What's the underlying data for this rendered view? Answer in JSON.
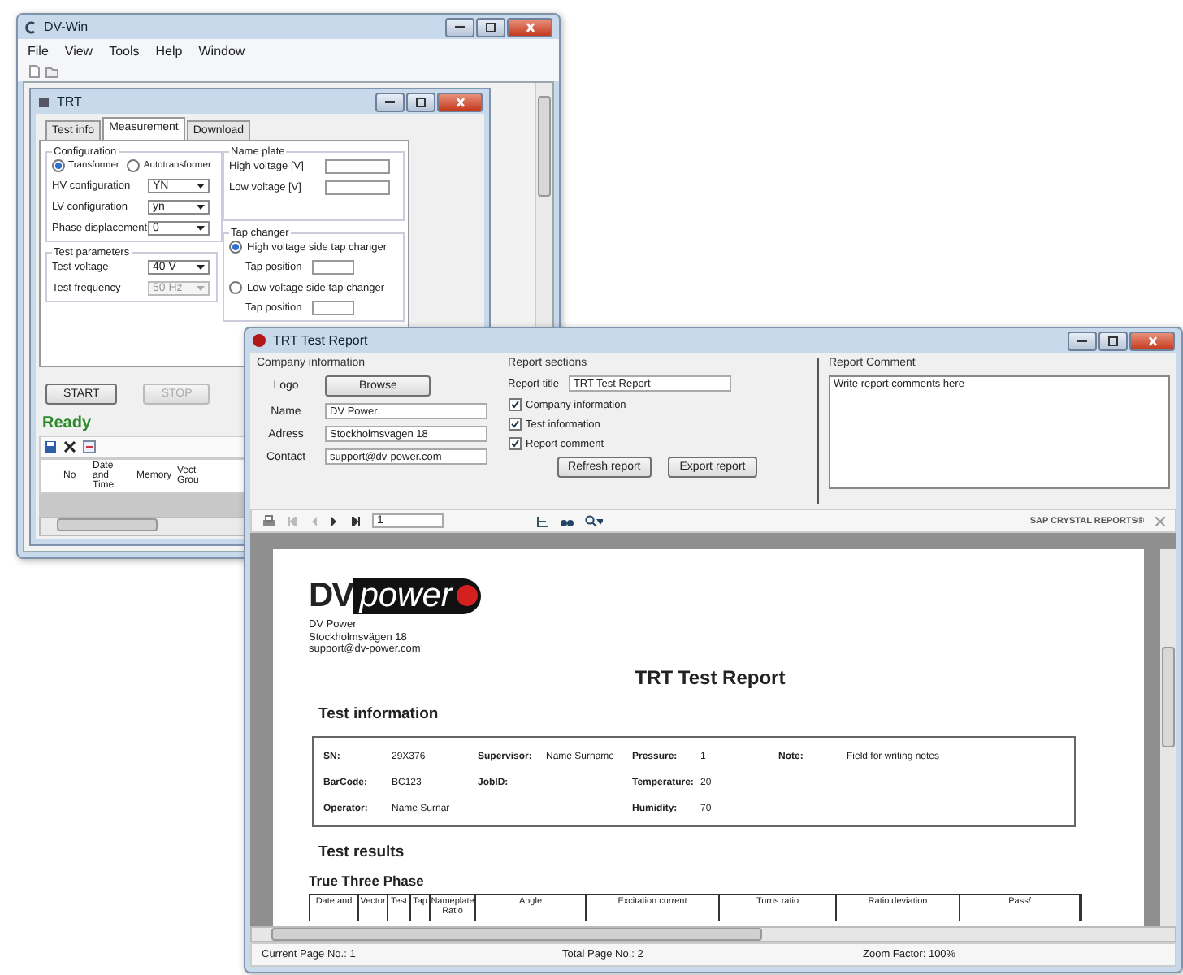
{
  "main_window": {
    "title": "DV-Win",
    "menu": [
      "File",
      "View",
      "Tools",
      "Help",
      "Window"
    ]
  },
  "trt_window": {
    "title": "TRT",
    "tabs": [
      {
        "label": "Test info",
        "selected": false
      },
      {
        "label": "Measurement",
        "selected": true
      },
      {
        "label": "Download",
        "selected": false
      }
    ],
    "configuration": {
      "title": "Configuration",
      "types": [
        {
          "label": "Transformer",
          "selected": true
        },
        {
          "label": "Autotransformer",
          "selected": false
        }
      ],
      "fields": [
        {
          "label": "HV configuration",
          "value": "YN",
          "disabled": false
        },
        {
          "label": "LV configuration",
          "value": "yn",
          "disabled": false
        },
        {
          "label": "Phase displacement",
          "value": "0",
          "disabled": false
        }
      ]
    },
    "test_parameters": {
      "title": "Test parameters",
      "fields": [
        {
          "label": "Test voltage",
          "value": "40 V",
          "disabled": false
        },
        {
          "label": "Test frequency",
          "value": "50 Hz",
          "disabled": true
        }
      ]
    },
    "name_plate": {
      "title": "Name plate",
      "fields": [
        {
          "label": "High voltage [V]"
        },
        {
          "label": "Low voltage [V]"
        }
      ]
    },
    "tap_changer": {
      "title": "Tap changer",
      "options": [
        {
          "label": "High voltage side tap changer",
          "selected": true,
          "position_label": "Tap position"
        },
        {
          "label": "Low voltage side tap changer",
          "selected": false,
          "position_label": "Tap position"
        }
      ]
    },
    "buttons": [
      {
        "label": "START",
        "disabled": false
      },
      {
        "label": "STOP",
        "disabled": true
      }
    ],
    "status": "Ready",
    "results_table": {
      "columns": [
        "No",
        "Date and Time",
        "Memory",
        "Vect Grou"
      ]
    }
  },
  "report_window": {
    "title": "TRT Test Report",
    "company_information": {
      "title": "Company information",
      "logo_label": "Logo",
      "browse_button": "Browse",
      "fields": [
        {
          "label": "Name",
          "value": "DV Power"
        },
        {
          "label": "Adress",
          "value": "Stockholmsvagen 18"
        },
        {
          "label": "Contact",
          "value": "support@dv-power.com"
        }
      ]
    },
    "report_sections": {
      "title": "Report sections",
      "report_title_label": "Report title",
      "report_title": "TRT Test Report",
      "options": [
        {
          "label": "Company information",
          "checked": true
        },
        {
          "label": "Test information",
          "checked": true
        },
        {
          "label": "Report comment",
          "checked": true
        }
      ],
      "buttons": [
        "Refresh report",
        "Export report"
      ]
    },
    "report_comment": {
      "title": "Report Comment",
      "value": "Write report comments here"
    },
    "viewer_toolbar": {
      "page": "1",
      "brand": "SAP CRYSTAL REPORTS®"
    },
    "page": {
      "logo": {
        "prefix": "DV",
        "suffix": "power"
      },
      "company_lines": [
        "DV Power",
        "Stockholmsvägen 18",
        "support@dv-power.com"
      ],
      "title": "TRT Test Report",
      "test_information": {
        "heading": "Test information",
        "columns": [
          [
            {
              "label": "SN:",
              "value": "29X376"
            },
            {
              "label": "BarCode:",
              "value": "BC123"
            },
            {
              "label": "Operator:",
              "value": "Name Surnar"
            }
          ],
          [
            {
              "label": "Supervisor:",
              "value": "Name Surname"
            },
            {
              "label": "JobID:"
            }
          ],
          [
            {
              "label": "Pressure:",
              "value": "1"
            },
            {
              "label": "Temperature:",
              "value": "20"
            },
            {
              "label": "Humidity:",
              "value": "70"
            }
          ],
          [
            {
              "label": "Note:",
              "value": "Field for writing notes"
            }
          ]
        ]
      },
      "test_results_heading": "Test results",
      "table_title": "True Three Phase",
      "table_columns": [
        "Date and",
        "Vector",
        "Test",
        "Tap",
        "Nameplate Ratio",
        "Angle",
        "Excitation current",
        "Turns ratio",
        "Ratio deviation",
        "Pass/"
      ]
    },
    "status_bar": [
      "Current Page No.: 1",
      "Total Page No.: 2",
      "Zoom Factor: 100%"
    ]
  }
}
